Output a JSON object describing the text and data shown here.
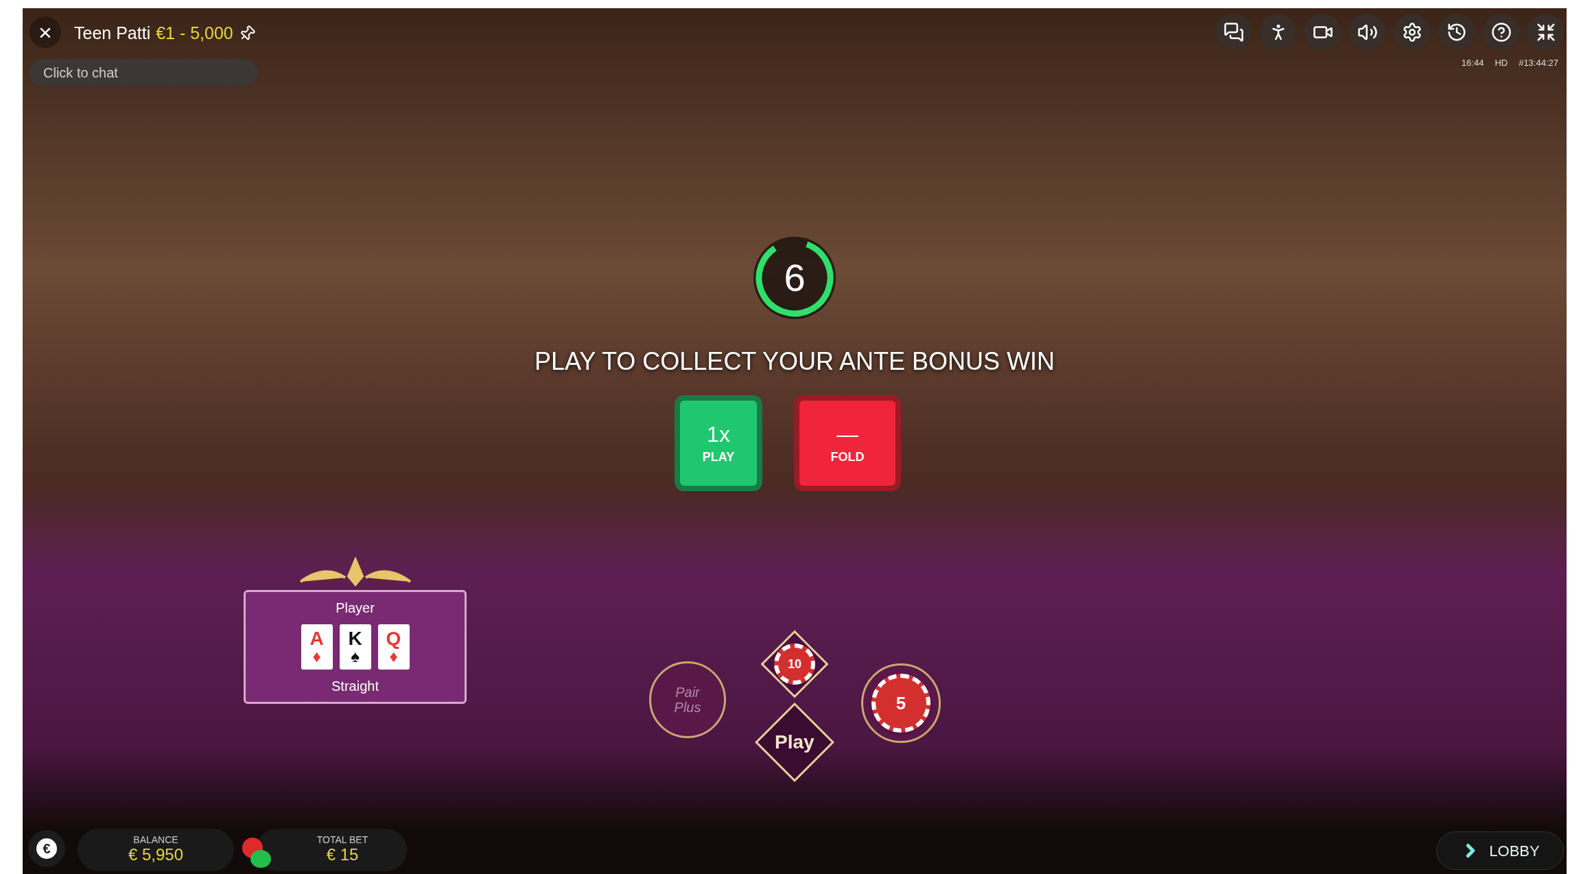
{
  "header": {
    "close": "×",
    "title": "Teen Patti",
    "limits": "€1 - 5,000",
    "chat_placeholder": "Click to chat"
  },
  "stream_info": {
    "time": "16:44",
    "quality": "HD",
    "round_id": "#13:44:27"
  },
  "timer": {
    "count": "6",
    "level": 0.85
  },
  "prompt": "PLAY TO COLLECT YOUR ANTE BONUS WIN",
  "decisions": [
    {
      "kind": "play",
      "value": "1x",
      "label": "PLAY"
    },
    {
      "kind": "fold",
      "value": "—",
      "label": "FOLD"
    }
  ],
  "player_hand": {
    "title": "Player",
    "cards": [
      {
        "rank": "A",
        "suit": "♦",
        "color": "#e53935"
      },
      {
        "rank": "K",
        "suit": "♠",
        "color": "#111111"
      },
      {
        "rank": "Q",
        "suit": "♦",
        "color": "#e53935"
      }
    ],
    "result": "Straight"
  },
  "bet_spots": [
    {
      "kind": "circle",
      "label": "Pair Plus"
    },
    {
      "kind": "chip-diamond",
      "chip": "10"
    },
    {
      "kind": "diamond",
      "label": "Play"
    },
    {
      "kind": "chip-circle",
      "chip": "5"
    }
  ],
  "footer": {
    "currency": "€",
    "balance": {
      "label": "BALANCE",
      "value": "€ 5,950"
    },
    "total_bet": {
      "label": "TOTAL BET",
      "value": "€ 15"
    },
    "lobby": "LOBBY"
  }
}
